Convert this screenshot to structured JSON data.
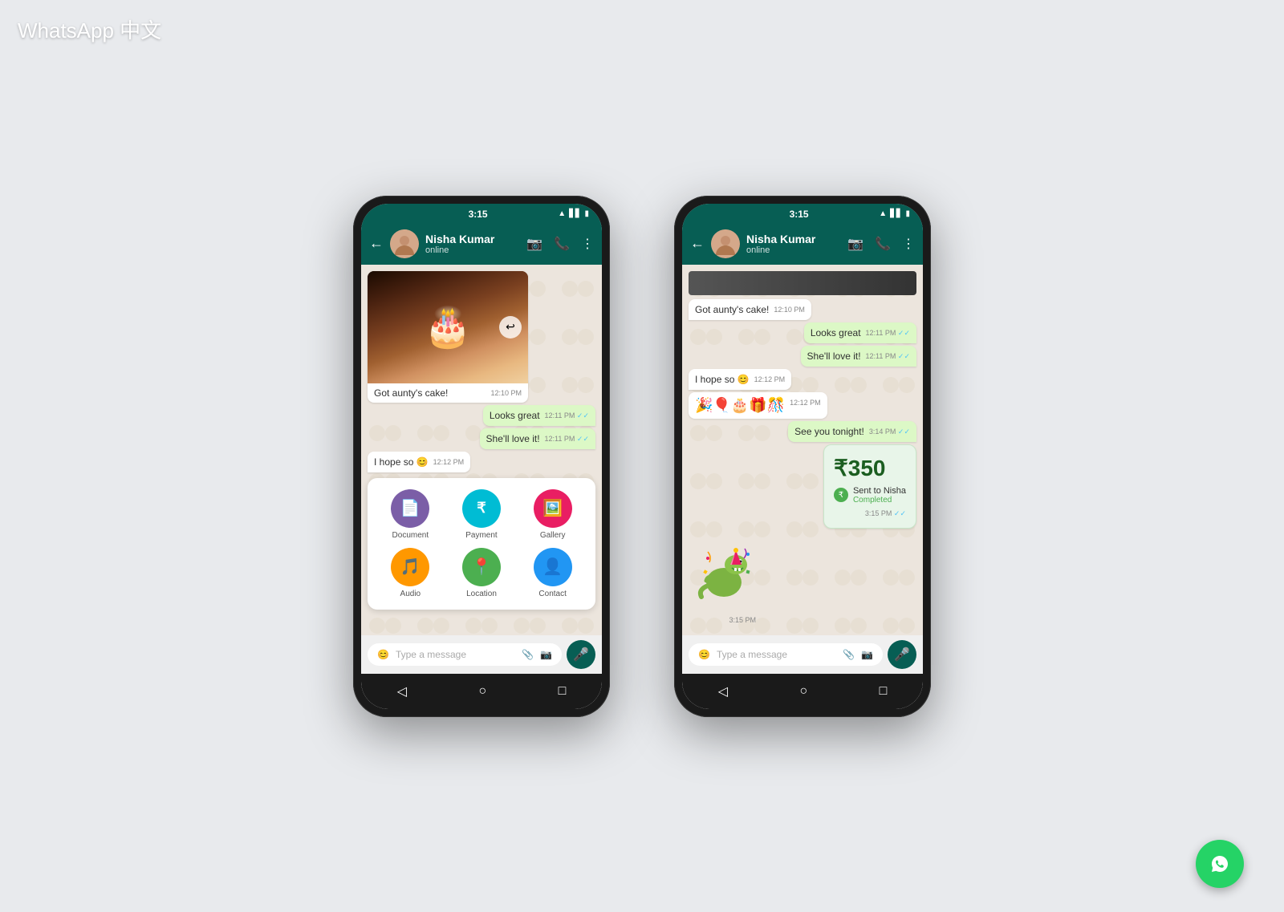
{
  "watermark": "WhatsApp 中文",
  "phone1": {
    "statusBar": {
      "time": "3:15",
      "icons": [
        "📶",
        "🔋"
      ]
    },
    "header": {
      "contactName": "Nisha Kumar",
      "status": "online",
      "backLabel": "←",
      "videoIcon": "📹",
      "callIcon": "📞",
      "menuIcon": "⋮"
    },
    "messages": [
      {
        "type": "image",
        "caption": "Got aunty's cake!",
        "time": "12:10 PM",
        "from": "received"
      },
      {
        "type": "text",
        "text": "Looks great",
        "time": "12:11 PM",
        "ticks": "✓✓",
        "from": "sent"
      },
      {
        "type": "text",
        "text": "She'll love it!",
        "time": "12:11 PM",
        "ticks": "✓✓",
        "from": "sent"
      },
      {
        "type": "text",
        "text": "I hope so 😊",
        "time": "12:12 PM",
        "from": "received"
      }
    ],
    "attachMenu": {
      "items": [
        {
          "label": "Document",
          "icon": "📄",
          "color": "#7B5EA7"
        },
        {
          "label": "Payment",
          "icon": "₹",
          "color": "#00BCD4"
        },
        {
          "label": "Gallery",
          "icon": "🖼️",
          "color": "#E91E63"
        },
        {
          "label": "Audio",
          "icon": "🎵",
          "color": "#FF9800"
        },
        {
          "label": "Location",
          "icon": "📍",
          "color": "#4CAF50"
        },
        {
          "label": "Contact",
          "icon": "👤",
          "color": "#2196F3"
        }
      ]
    },
    "inputBar": {
      "placeholder": "Type a message",
      "emojiIcon": "😊",
      "attachIcon": "📎",
      "cameraIcon": "📷",
      "micIcon": "🎤"
    },
    "navBar": {
      "back": "◁",
      "home": "○",
      "recent": "□"
    }
  },
  "phone2": {
    "statusBar": {
      "time": "3:15"
    },
    "header": {
      "contactName": "Nisha Kumar",
      "status": "online"
    },
    "messages": [
      {
        "type": "text",
        "text": "Got aunty's cake!",
        "time": "12:10 PM",
        "from": "received"
      },
      {
        "type": "text",
        "text": "Looks great",
        "time": "12:11 PM",
        "ticks": "✓✓",
        "from": "sent"
      },
      {
        "type": "text",
        "text": "She'll love it!",
        "time": "12:11 PM",
        "ticks": "✓✓",
        "from": "sent"
      },
      {
        "type": "text",
        "text": "I hope so 😊",
        "time": "12:12 PM",
        "from": "received"
      },
      {
        "type": "emoji",
        "text": "🎉🎈🎂🎁🎊",
        "time": "12:12 PM",
        "from": "received"
      },
      {
        "type": "text",
        "text": "See you tonight!",
        "time": "3:14 PM",
        "ticks": "✓✓",
        "from": "sent"
      },
      {
        "type": "payment",
        "amount": "₹350",
        "to": "Sent to Nisha",
        "status": "Completed",
        "time": "3:15 PM",
        "ticks": "✓✓"
      },
      {
        "type": "sticker",
        "emoji": "🦕",
        "time": "3:15 PM"
      }
    ],
    "inputBar": {
      "placeholder": "Type a message"
    },
    "navBar": {
      "back": "◁",
      "home": "○",
      "recent": "□"
    }
  },
  "fab": {
    "icon": "💬",
    "color": "#25D366"
  }
}
